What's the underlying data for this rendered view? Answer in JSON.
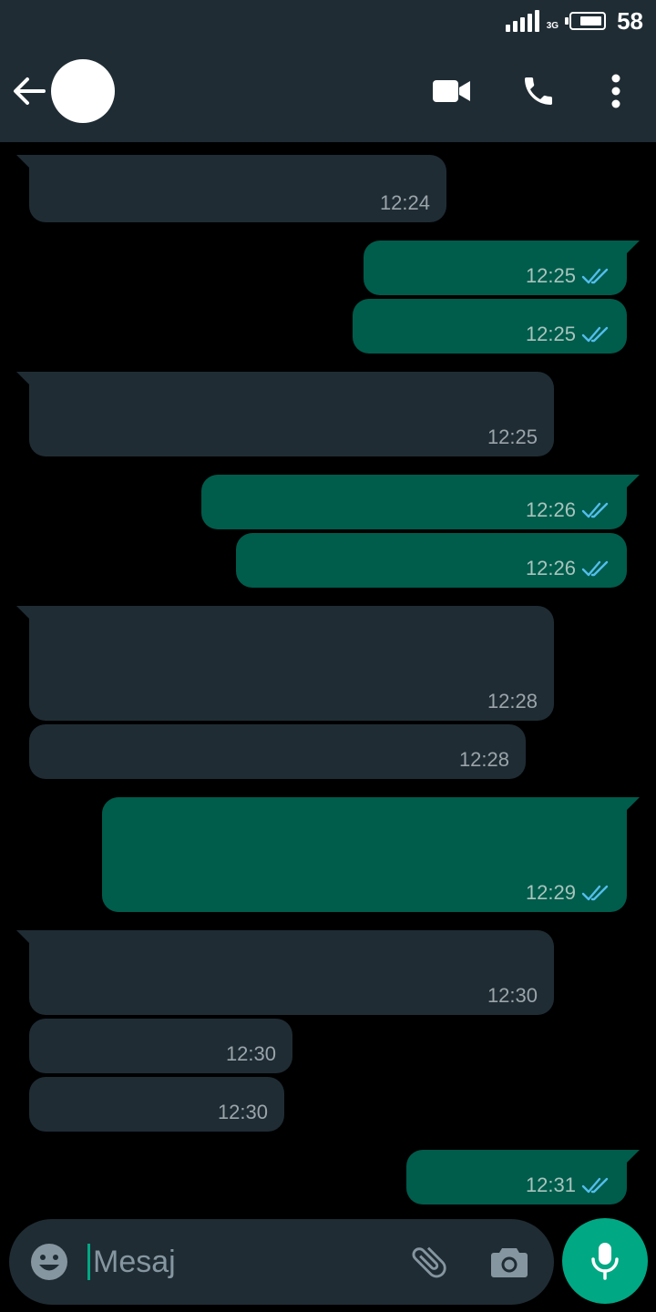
{
  "status_bar": {
    "network": "3G",
    "battery_percent": "58"
  },
  "header": {
    "back_icon": "arrow-left-icon",
    "avatar": "avatar",
    "icons": [
      "video-call-icon",
      "phone-icon",
      "more-vert-icon"
    ]
  },
  "messages": [
    {
      "direction": "in",
      "time": "12:24"
    },
    {
      "direction": "out",
      "time": "12:25",
      "read": true
    },
    {
      "direction": "out",
      "time": "12:25",
      "read": true
    },
    {
      "direction": "in",
      "time": "12:25"
    },
    {
      "direction": "out",
      "time": "12:26",
      "read": true
    },
    {
      "direction": "out",
      "time": "12:26",
      "read": true
    },
    {
      "direction": "in",
      "time": "12:28"
    },
    {
      "direction": "in",
      "time": "12:28"
    },
    {
      "direction": "out",
      "time": "12:29",
      "read": true
    },
    {
      "direction": "in",
      "time": "12:30"
    },
    {
      "direction": "in",
      "time": "12:30"
    },
    {
      "direction": "in",
      "time": "12:30"
    },
    {
      "direction": "out",
      "time": "12:31",
      "read": true
    }
  ],
  "composer": {
    "placeholder": "Mesaj"
  },
  "colors": {
    "header_bg": "#1f2c34",
    "incoming_bubble": "#1f2c34",
    "outgoing_bubble": "#005c4b",
    "read_ticks": "#53bdeb",
    "accent": "#00a884"
  }
}
